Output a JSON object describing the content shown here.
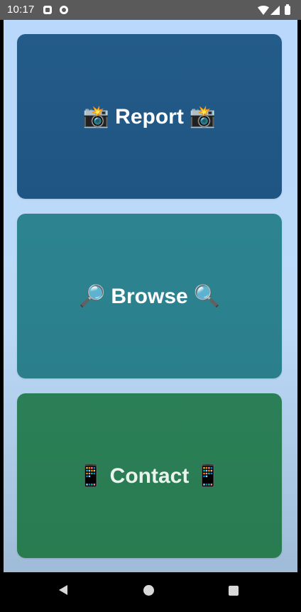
{
  "status_bar": {
    "time": "10:17",
    "notification_icons": [
      "accessibility-icon",
      "app-notification-icon"
    ]
  },
  "cards": [
    {
      "name": "report",
      "label": "Report",
      "emoji": "📸",
      "color": "#225a86"
    },
    {
      "name": "browse",
      "label": "Browse",
      "emoji": "🔎",
      "emoji_right": "🔍",
      "color": "#2d8390"
    },
    {
      "name": "contact",
      "label": "Contact",
      "emoji": "📱",
      "color": "#2b7e54"
    }
  ],
  "colors": {
    "status_bar": "#5a5a5a",
    "background_top": "#b9d8fb",
    "background_bottom": "#9fbbd7",
    "nav_bar": "#000000"
  },
  "nav_bar": {
    "buttons": [
      "back",
      "home",
      "recents"
    ]
  }
}
